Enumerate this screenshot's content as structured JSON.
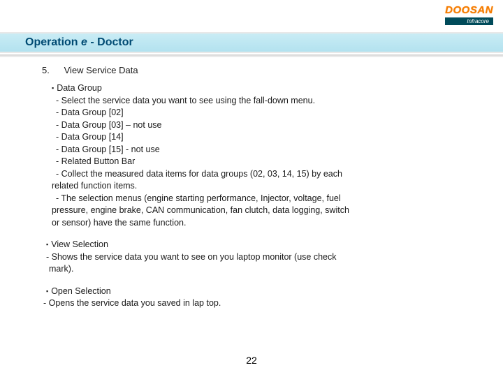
{
  "logo": {
    "main": "DOOSAN",
    "sub": "Infracore"
  },
  "header": {
    "title_pre": "Operation ",
    "title_em": "e",
    "title_post": " - Doctor"
  },
  "section": {
    "number": "5.",
    "title": "View Service Data"
  },
  "b1": {
    "head": "Data Group",
    "l1": "- Select the service data you want to see using the fall-down menu.",
    "l2": "- Data Group [02]",
    "l3": "- Data Group [03] – not  use",
    "l4": "- Data Group [14]",
    "l5": "- Data Group [15] - not use",
    "l6": "- Related Button Bar",
    "l7": "- Collect the measured data items for data groups (02, 03, 14, 15) by each",
    "l7b": "related function items.",
    "l8": " - The selection menus (engine starting performance, Injector, voltage, fuel",
    "l8b": "pressure, engine brake, CAN communication, fan clutch, data logging, switch",
    "l8c": "or sensor) have the same function."
  },
  "b2": {
    "head": "View Selection",
    "l1": "- Shows the service data you want to see on you laptop monitor (use check",
    "l1b": "mark)."
  },
  "b3": {
    "head": "Open Selection",
    "l1": "- Opens the service data you saved in lap top."
  },
  "page": "22"
}
